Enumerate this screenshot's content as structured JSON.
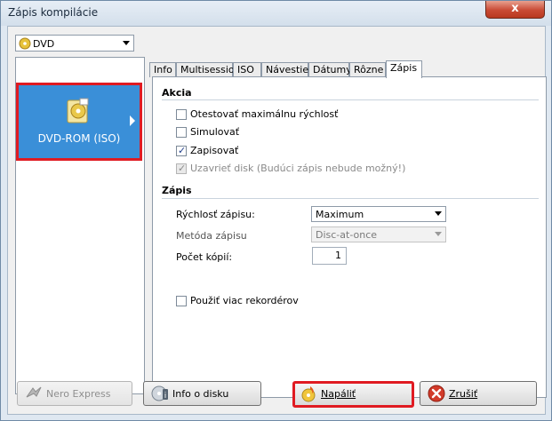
{
  "window": {
    "title": "Zápis kompilácie",
    "close_glyph": "x"
  },
  "media_selector": {
    "value": "DVD"
  },
  "media_item": {
    "label": "DVD-ROM (ISO)",
    "icon": "dvd-disc-icon"
  },
  "tabs": [
    {
      "label": "Info"
    },
    {
      "label": "Multisession"
    },
    {
      "label": "ISO"
    },
    {
      "label": "Návestie"
    },
    {
      "label": "Dátumy"
    },
    {
      "label": "Rôzne"
    },
    {
      "label": "Zápis",
      "active": true
    }
  ],
  "akcia": {
    "title": "Akcia",
    "options": [
      {
        "label": "Otestovať maximálnu rýchlosť",
        "checked": false
      },
      {
        "label": "Simulovať",
        "checked": false
      },
      {
        "label": "Zapisovať",
        "checked": true
      },
      {
        "label": "Uzavrieť disk (Budúci zápis nebude možný!)",
        "checked": true,
        "disabled": true
      }
    ]
  },
  "zapis": {
    "title": "Zápis",
    "speed_label": "Rýchlosť zápisu:",
    "speed_value": "Maximum",
    "method_label": "Metóda zápisu",
    "method_value": "Disc-at-once",
    "copies_label": "Počet kópií:",
    "copies_value": "1",
    "multi_recorder_label": "Použiť viac rekordérov"
  },
  "check_glyph": "✓",
  "buttons": {
    "nero_express": "Nero Express",
    "disc_info": "Info o disku",
    "burn": "Napáliť",
    "cancel": "Zrušiť"
  },
  "colors": {
    "accent": "#3a8fd8",
    "highlight": "#e01b22"
  }
}
